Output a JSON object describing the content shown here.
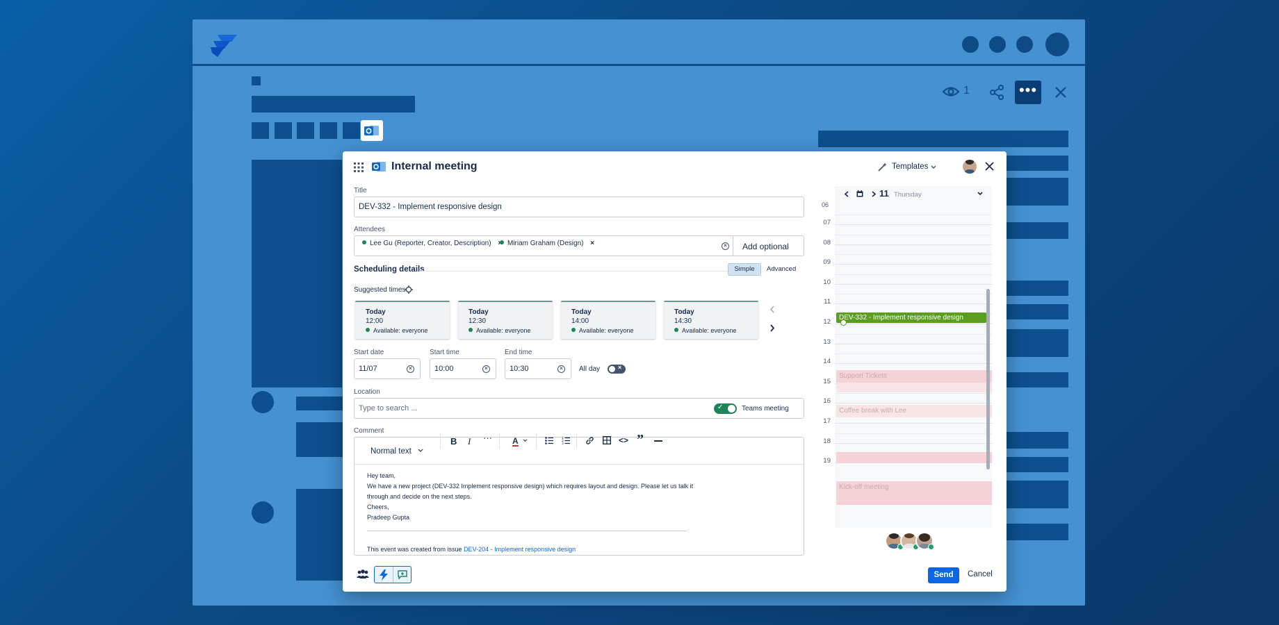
{
  "background_window": {
    "viewer_count": "1"
  },
  "modal": {
    "title": "Internal meeting",
    "templates_label": "Templates",
    "title_field": {
      "label": "Title",
      "value": "DEV-332 - Implement responsive design"
    },
    "attendees": {
      "label": "Attendees",
      "chips": [
        {
          "name": "Lee Gu (Reporter, Creator, Description)"
        },
        {
          "name": "Miriam Graham (Design)"
        }
      ],
      "add_optional": "Add optional"
    },
    "scheduling": {
      "label": "Scheduling details",
      "mode_simple": "Simple",
      "mode_advanced": "Advanced",
      "suggested_label": "Suggested times",
      "slots": [
        {
          "day": "Today",
          "time": "12:00",
          "availability": "Available: everyone"
        },
        {
          "day": "Today",
          "time": "12:30",
          "availability": "Available: everyone"
        },
        {
          "day": "Today",
          "time": "14:00",
          "availability": "Available: everyone"
        },
        {
          "day": "Today",
          "time": "14:30",
          "availability": "Available: everyone"
        }
      ]
    },
    "start_date": {
      "label": "Start date",
      "value": "11/07"
    },
    "start_time": {
      "label": "Start time",
      "value": "10:00"
    },
    "end_time": {
      "label": "End time",
      "value": "10:30"
    },
    "all_day": {
      "label": "All day",
      "on": false
    },
    "location": {
      "label": "Location",
      "placeholder": "Type to search ...",
      "teams_label": "Teams meeting",
      "teams_on": true
    },
    "comment": {
      "label": "Comment",
      "text_style": "Normal text",
      "lines": [
        "Hey team,",
        "We have a new project (DEV-332 Implement responsive design) which requires layout and design. Please let us talk it",
        "through and decide on the next steps.",
        "Cheers,",
        "Pradeep Gupta"
      ],
      "footer_prefix": "This event was created from issue ",
      "footer_link": "DEV-204 - Implement responsive design"
    },
    "send_label": "Send",
    "cancel_label": "Cancel"
  },
  "calendar": {
    "day_number": "11",
    "day_name": "Thursday",
    "hours": [
      "07",
      "08",
      "09",
      "10",
      "11",
      "12",
      "13",
      "14",
      "15",
      "16",
      "17",
      "18",
      "19"
    ],
    "events": [
      {
        "title": "DEV-332 - Implement responsive design",
        "active": true
      },
      {
        "title": "Support Tickets",
        "active": false
      },
      {
        "title": "Coffee break with Lee",
        "active": false
      },
      {
        "title": "",
        "active": false
      },
      {
        "title": "Kick-off meeting",
        "active": false
      }
    ]
  },
  "colors": {
    "primary": "#0c66e4",
    "active_event": "#5b9e1f",
    "busy_event": "#f5d2d8",
    "available": "#1f845a",
    "outlook": "#0f6cbd"
  },
  "icons": {
    "app_grid": "grid-icon",
    "outlook": "outlook-icon",
    "templates": "magic-wand-icon",
    "close": "close-icon",
    "settings": "gear-icon",
    "teams": "people-icon",
    "lightning": "lightning-icon",
    "feedback": "feedback-icon"
  }
}
